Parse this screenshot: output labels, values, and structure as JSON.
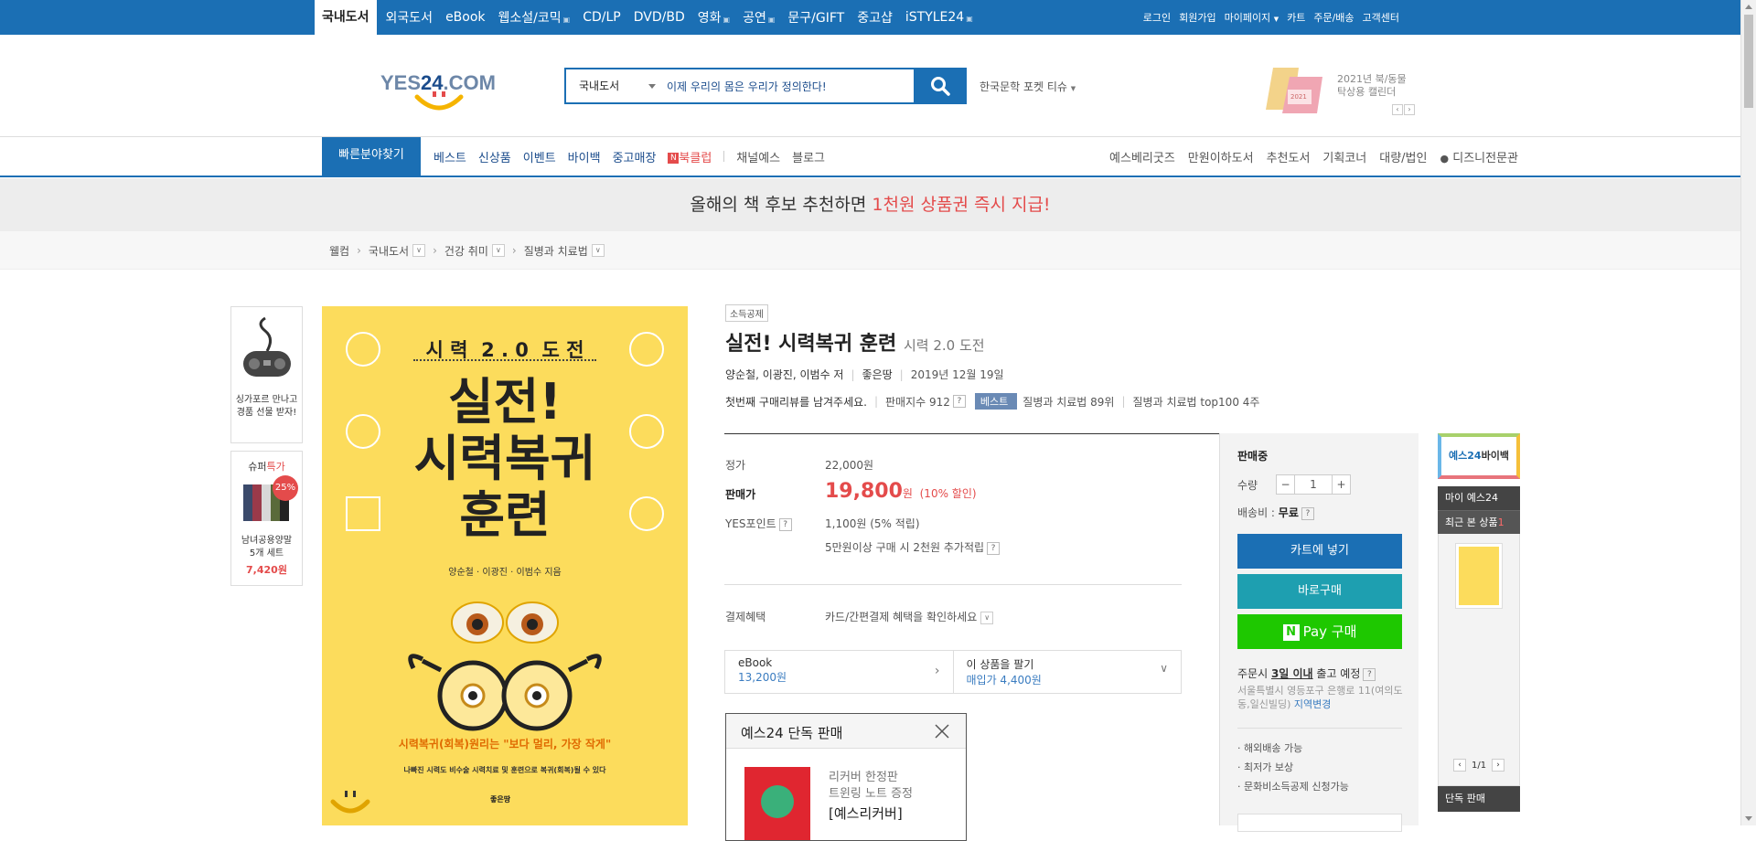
{
  "topnav": {
    "items": [
      "국내도서",
      "외국도서",
      "eBook",
      "웹소설/코믹",
      "CD/LP",
      "DVD/BD",
      "영화",
      "공연",
      "문구/GIFT",
      "중고샵",
      "iSTYLE24"
    ]
  },
  "util": {
    "items": [
      "로그인",
      "회원가입",
      "마이페이지",
      "카트",
      "주문/배송",
      "고객센터"
    ]
  },
  "logo": {
    "text_a": "YES",
    "text_b": "24",
    "text_c": ".COM"
  },
  "search": {
    "category": "국내도서",
    "value": "이제 우리의 몸은 우리가 정의한다!",
    "keyword": "한국문학 포켓 티슈"
  },
  "ad": {
    "line1": "2021년 북/동물",
    "line2": "탁상용 캘린더",
    "cal": "2021"
  },
  "gnb": {
    "quick": "빠른분야찾기",
    "left": [
      "베스트",
      "신상품",
      "이벤트",
      "바이백",
      "중고매장",
      "북클럽",
      "채널예스",
      "블로그"
    ],
    "right": [
      "예스베리굿즈",
      "만원이하도서",
      "추천도서",
      "기획코너",
      "대량/법인",
      "디즈니전문관"
    ]
  },
  "banner": {
    "text_a": "올해의 책 후보 추천하면 ",
    "text_b": "1천원 상품권 즉시 지급!"
  },
  "breadcrumb": [
    "웰컴",
    "국내도서",
    "건강 취미",
    "질병과 치료법"
  ],
  "leftside": {
    "promo": "싱가포르 만나고 경품 선물 받자!",
    "super_a": "슈퍼",
    "super_b": "특가",
    "discount": "25%",
    "product": "남녀공용양말 5개 세트",
    "price": "7,420원"
  },
  "cover": {
    "top": "시 력  2 . 0  도 전",
    "title1": "실전!",
    "title2": "시력복귀",
    "title3": "훈련",
    "authors": "양순철 · 이광진 · 이범수 지음",
    "slogan": "시력복귀(회복)원리는 \"보다 멀리, 가장 작게\"",
    "desc": "나빠진 시력도 비수술 시력치료 및 훈련으로 복귀(회복)될 수 있다",
    "publisher": "좋은땅"
  },
  "product": {
    "tag": "소득공제",
    "title": "실전! 시력복귀 훈련",
    "subtitle": "시력 2.0 도전",
    "authors": "양순철, 이광진, 이범수 저",
    "publisher": "좋은땅",
    "date": "2019년 12월 19일",
    "review": "첫번째 구매리뷰를 남겨주세요.",
    "sales_index": "판매지수 912",
    "best_label": "베스트",
    "rank1": "질병과 치료법 89위",
    "rank2": "질병과 치료법 top100 4주"
  },
  "price": {
    "list_label": "정가",
    "list_value": "22,000원",
    "sale_label": "판매가",
    "sale_value": "19,800",
    "sale_unit": "원",
    "discount": "(10% 할인)",
    "point_label": "YES포인트",
    "point_value": "1,100원 (5% 적립)",
    "point_extra": "5만원이상 구매 시 2천원 추가적립",
    "pay_label": "결제혜택",
    "pay_value": "카드/간편결제 혜택을 확인하세요"
  },
  "ebook": {
    "label": "eBook",
    "price": "13,200원",
    "sell_label": "이 상품을 팔기",
    "sell_price": "매입가 4,400원"
  },
  "exclusive": {
    "title": "예스24 단독 판매",
    "l1": "리커버 한정판",
    "l2": "트윈링 노트 증정",
    "l3": "[예스리커버]"
  },
  "buy": {
    "status": "판매중",
    "qty_label": "수량",
    "qty": "1",
    "ship_label": "배송비 : ",
    "ship_value": "무료",
    "cart": "카트에 넣기",
    "buy_now": "바로구매",
    "npay": "Pay 구매",
    "order_a": "주문시 ",
    "order_b": "3일 이내",
    "order_c": " 출고 예정",
    "address": "서울특별시 영등포구 은행로 11(여의도동,일신빌딩)",
    "region": "지역변경",
    "features": [
      "해외배송 가능",
      "최저가 보상",
      "문화비소득공제 신청가능"
    ]
  },
  "rside": {
    "buyback_a": "예스24",
    "buyback_b": "바이백",
    "my": "마이 예스24",
    "recent": "최근 본 상품",
    "recent_count": "1",
    "page": "1/1",
    "exclusive": "단독 판매"
  }
}
